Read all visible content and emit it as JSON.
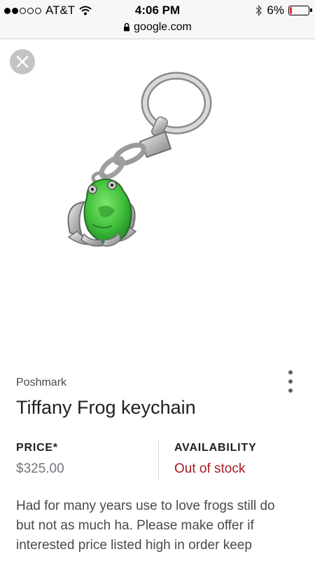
{
  "status_bar": {
    "carrier": "AT&T",
    "time": "4:06 PM",
    "battery_percent": "6%",
    "signal_bars": 2,
    "battery_level": 0.06
  },
  "url_bar": {
    "domain": "google.com"
  },
  "product": {
    "merchant": "Poshmark",
    "title": "Tiffany Frog keychain",
    "price_label": "PRICE*",
    "price": "$325.00",
    "availability_label": "AVAILABILITY",
    "availability": "Out of stock",
    "description": "Had for many years use to love frogs still do but not as much ha. Please make offer if interested price listed high in order keep"
  },
  "colors": {
    "out_of_stock": "#a51d22",
    "frog_green": "#3fbf3a",
    "battery_low": "#e0302c"
  },
  "icons": [
    "wifi-icon",
    "bluetooth-icon",
    "lock-icon",
    "close-icon",
    "more-vert-icon"
  ]
}
